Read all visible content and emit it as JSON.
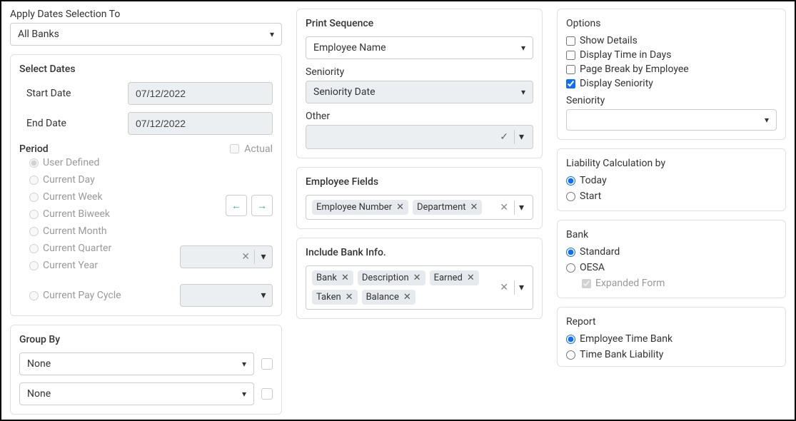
{
  "apply_dates": {
    "label": "Apply Dates Selection To",
    "selected": "All Banks"
  },
  "select_dates": {
    "title": "Select Dates",
    "start_label": "Start Date",
    "start_value": "07/12/2022",
    "end_label": "End Date",
    "end_value": "07/12/2022"
  },
  "period": {
    "title": "Period",
    "actual_label": "Actual",
    "options": {
      "user_defined": "User Defined",
      "current_day": "Current Day",
      "current_week": "Current Week",
      "current_biweek": "Current Biweek",
      "current_month": "Current Month",
      "current_quarter": "Current Quarter",
      "current_year": "Current Year",
      "current_pay_cycle": "Current Pay Cycle"
    }
  },
  "group_by": {
    "title": "Group By",
    "option1": "None",
    "option2": "None"
  },
  "print_sequence": {
    "title": "Print Sequence",
    "selected": "Employee Name",
    "seniority_label": "Seniority",
    "seniority_selected": "Seniority Date",
    "other_label": "Other"
  },
  "employee_fields": {
    "title": "Employee Fields",
    "tags": {
      "t1": "Employee Number",
      "t2": "Department"
    }
  },
  "include_bank": {
    "title": "Include Bank Info.",
    "tags": {
      "t1": "Bank",
      "t2": "Description",
      "t3": "Earned",
      "t4": "Taken",
      "t5": "Balance"
    }
  },
  "options": {
    "title": "Options",
    "show_details": "Show Details",
    "display_time": "Display Time in Days",
    "page_break": "Page Break by Employee",
    "display_seniority": "Display Seniority",
    "seniority_label": "Seniority"
  },
  "liability": {
    "title": "Liability Calculation by",
    "today": "Today",
    "start": "Start"
  },
  "bank": {
    "title": "Bank",
    "standard": "Standard",
    "oesa": "OESA",
    "expanded": "Expanded Form"
  },
  "report": {
    "title": "Report",
    "etb": "Employee Time Bank",
    "tbl": "Time Bank Liability"
  },
  "symbols": {
    "caret": "▾",
    "x": "✕",
    "check": "✓",
    "arrow_left": "←",
    "arrow_right": "→"
  }
}
